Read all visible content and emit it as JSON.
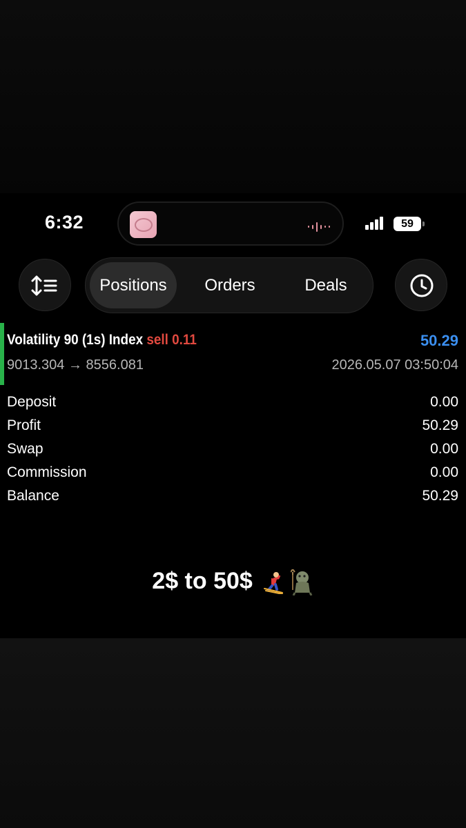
{
  "status_bar": {
    "time": "6:32",
    "battery": "59",
    "icons": [
      "album-thumbnail-icon",
      "audio-wave-icon",
      "signal-bars-icon",
      "battery-icon"
    ]
  },
  "toolbar": {
    "tabs": [
      {
        "label": "Positions",
        "active": true
      },
      {
        "label": "Orders",
        "active": false
      },
      {
        "label": "Deals",
        "active": false
      }
    ],
    "left_icon": "sort-icon",
    "right_icon": "clock-icon"
  },
  "position": {
    "symbol": "Volatility 90 (1s) Index",
    "side": "sell 0.11",
    "profit": "50.29",
    "prices": "9013.304 → 8556.081",
    "datetime": "2026.05.07 03:50:04"
  },
  "summary": [
    {
      "label": "Deposit",
      "value": "0.00"
    },
    {
      "label": "Profit",
      "value": "50.29"
    },
    {
      "label": "Swap",
      "value": "0.00"
    },
    {
      "label": "Commission",
      "value": "0.00"
    },
    {
      "label": "Balance",
      "value": "50.29"
    }
  ],
  "caption": {
    "text": "2$ to 50$",
    "emoji": [
      "skier-icon",
      "troll-icon"
    ]
  },
  "colors": {
    "sell": "#e1493f",
    "profit": "#3b8ff0",
    "accent": "#29b24a"
  }
}
